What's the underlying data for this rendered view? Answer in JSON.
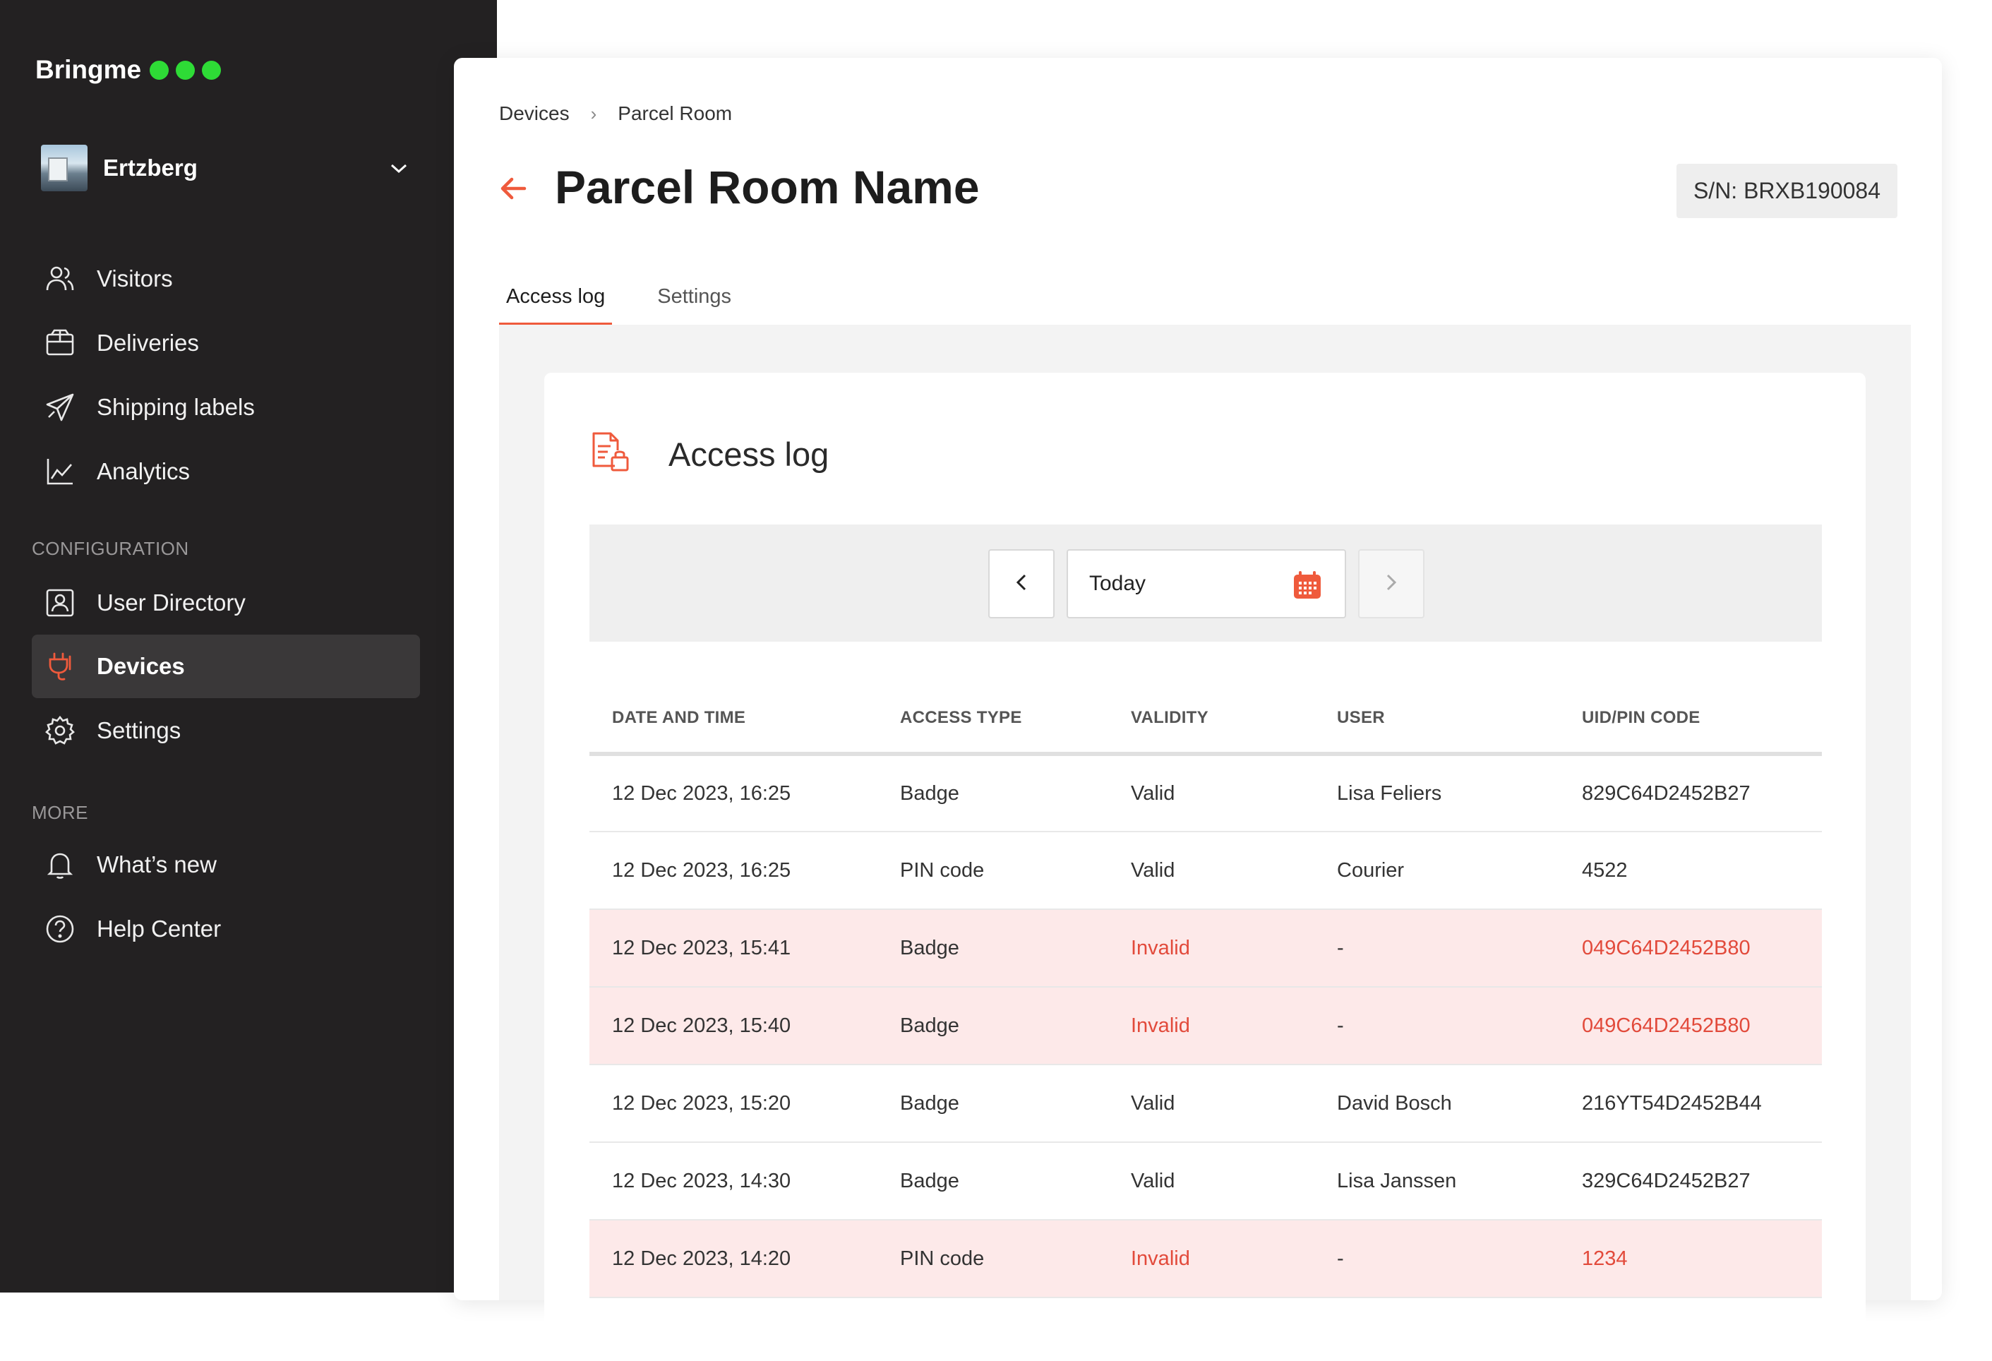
{
  "app": {
    "brand": "Bringme",
    "account": "Ertzberg"
  },
  "sidebar": {
    "items": [
      {
        "label": "Visitors",
        "icon": "users-icon"
      },
      {
        "label": "Deliveries",
        "icon": "box-icon"
      },
      {
        "label": "Shipping labels",
        "icon": "send-icon"
      },
      {
        "label": "Analytics",
        "icon": "chart-icon"
      }
    ],
    "config_title": "CONFIGURATION",
    "config_items": [
      {
        "label": "User Directory",
        "icon": "contact-card-icon"
      },
      {
        "label": "Devices",
        "icon": "plug-icon",
        "active": true
      },
      {
        "label": "Settings",
        "icon": "gear-icon"
      }
    ],
    "more_title": "MORE",
    "more_items": [
      {
        "label": "What’s new",
        "icon": "bell-icon"
      },
      {
        "label": "Help Center",
        "icon": "help-circle-icon"
      }
    ]
  },
  "page": {
    "breadcrumb": [
      "Devices",
      "Parcel Room"
    ],
    "title": "Parcel Room Name",
    "serial": "S/N: BRXB190084",
    "tabs": [
      {
        "label": "Access log",
        "active": true
      },
      {
        "label": "Settings",
        "active": false
      }
    ]
  },
  "card": {
    "title": "Access log",
    "date_value": "Today"
  },
  "table": {
    "headers": [
      "DATE AND TIME",
      "ACCESS TYPE",
      "VALIDITY",
      "USER",
      "UID/PIN CODE"
    ],
    "rows": [
      {
        "date": "12 Dec 2023, 16:25",
        "type": "Badge",
        "validity": "Valid",
        "user": "Lisa Feliers",
        "uid": "829C64D2452B27"
      },
      {
        "date": "12 Dec 2023, 16:25",
        "type": "PIN code",
        "validity": "Valid",
        "user": "Courier",
        "uid": "4522"
      },
      {
        "date": "12 Dec 2023, 15:41",
        "type": "Badge",
        "validity": "Invalid",
        "user": "-",
        "uid": "049C64D2452B80"
      },
      {
        "date": "12 Dec 2023, 15:40",
        "type": "Badge",
        "validity": "Invalid",
        "user": "-",
        "uid": "049C64D2452B80"
      },
      {
        "date": "12 Dec 2023, 15:20",
        "type": "Badge",
        "validity": "Valid",
        "user": "David Bosch",
        "uid": "216YT54D2452B44"
      },
      {
        "date": "12 Dec 2023, 14:30",
        "type": "Badge",
        "validity": "Valid",
        "user": "Lisa Janssen",
        "uid": "329C64D2452B27"
      },
      {
        "date": "12 Dec 2023, 14:20",
        "type": "PIN code",
        "validity": "Invalid",
        "user": "-",
        "uid": "1234"
      }
    ]
  },
  "colors": {
    "accent": "#ef5a3c",
    "sidebar_bg": "#232122",
    "status_dot": "#2edb36",
    "invalid_row": "#fde9e9",
    "invalid_text": "#e24a3b"
  }
}
